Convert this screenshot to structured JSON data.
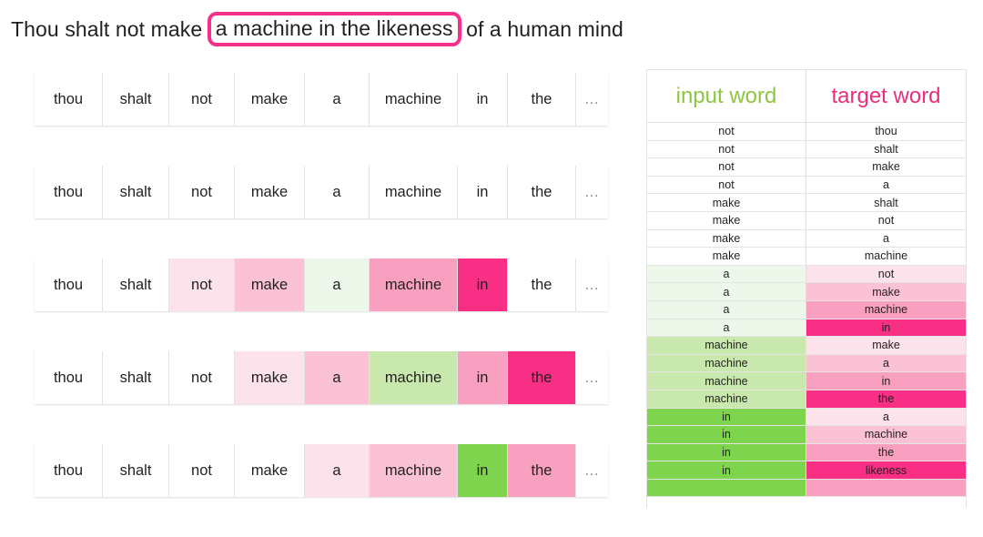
{
  "title": {
    "before": "Thou shalt not make",
    "highlight": "a machine in the likeness",
    "after": "of a human mind",
    "highlight_border_color": "#f7318a"
  },
  "palette": {
    "pink_1": "#fce2ea",
    "pink_2": "#fbc2d5",
    "pink_3": "#f9a0c0",
    "pink_4": "#f92f86",
    "green_1": "#eef8ea",
    "green_2": "#c8e8ae",
    "green_3": "#7fd44d",
    "white": "#ffffff",
    "header_green": "#8dc63f",
    "header_pink": "#ed2d7c",
    "border": "#e2e2e2"
  },
  "sentence_rows": [
    {
      "name": "row-1",
      "cells": [
        {
          "word": "thou",
          "bg": "#ffffff"
        },
        {
          "word": "shalt",
          "bg": "#ffffff"
        },
        {
          "word": "not",
          "bg": "#ffffff"
        },
        {
          "word": "make",
          "bg": "#ffffff"
        },
        {
          "word": "a",
          "bg": "#ffffff"
        },
        {
          "word": "machine",
          "bg": "#ffffff"
        },
        {
          "word": "in",
          "bg": "#ffffff"
        },
        {
          "word": "the",
          "bg": "#ffffff"
        },
        {
          "word": "…",
          "bg": "#ffffff"
        }
      ]
    },
    {
      "name": "row-2",
      "cells": [
        {
          "word": "thou",
          "bg": "#ffffff"
        },
        {
          "word": "shalt",
          "bg": "#ffffff"
        },
        {
          "word": "not",
          "bg": "#ffffff"
        },
        {
          "word": "make",
          "bg": "#ffffff"
        },
        {
          "word": "a",
          "bg": "#ffffff"
        },
        {
          "word": "machine",
          "bg": "#ffffff"
        },
        {
          "word": "in",
          "bg": "#ffffff"
        },
        {
          "word": "the",
          "bg": "#ffffff"
        },
        {
          "word": "…",
          "bg": "#ffffff"
        }
      ]
    },
    {
      "name": "row-3",
      "cells": [
        {
          "word": "thou",
          "bg": "#ffffff"
        },
        {
          "word": "shalt",
          "bg": "#ffffff"
        },
        {
          "word": "not",
          "bg": "#fce2ea"
        },
        {
          "word": "make",
          "bg": "#fbc2d5"
        },
        {
          "word": "a",
          "bg": "#eef8ea"
        },
        {
          "word": "machine",
          "bg": "#f9a0c0"
        },
        {
          "word": "in",
          "bg": "#f92f86"
        },
        {
          "word": "the",
          "bg": "#ffffff"
        },
        {
          "word": "…",
          "bg": "#ffffff"
        }
      ]
    },
    {
      "name": "row-4",
      "cells": [
        {
          "word": "thou",
          "bg": "#ffffff"
        },
        {
          "word": "shalt",
          "bg": "#ffffff"
        },
        {
          "word": "not",
          "bg": "#ffffff"
        },
        {
          "word": "make",
          "bg": "#fce2ea"
        },
        {
          "word": "a",
          "bg": "#fbc2d5"
        },
        {
          "word": "machine",
          "bg": "#c8e8ae"
        },
        {
          "word": "in",
          "bg": "#f9a0c0"
        },
        {
          "word": "the",
          "bg": "#f92f86"
        },
        {
          "word": "…",
          "bg": "#ffffff"
        }
      ]
    },
    {
      "name": "row-5",
      "cells": [
        {
          "word": "thou",
          "bg": "#ffffff"
        },
        {
          "word": "shalt",
          "bg": "#ffffff"
        },
        {
          "word": "not",
          "bg": "#ffffff"
        },
        {
          "word": "make",
          "bg": "#ffffff"
        },
        {
          "word": "a",
          "bg": "#fce2ea"
        },
        {
          "word": "machine",
          "bg": "#fbc2d5"
        },
        {
          "word": "in",
          "bg": "#7fd44d"
        },
        {
          "word": "the",
          "bg": "#f9a0c0"
        },
        {
          "word": "…",
          "bg": "#ffffff"
        }
      ]
    }
  ],
  "table": {
    "headers": {
      "input": "input word",
      "target": "target word"
    },
    "rows": [
      {
        "input": "not",
        "target": "thou",
        "input_bg": "#ffffff",
        "target_bg": "#ffffff"
      },
      {
        "input": "not",
        "target": "shalt",
        "input_bg": "#ffffff",
        "target_bg": "#ffffff"
      },
      {
        "input": "not",
        "target": "make",
        "input_bg": "#ffffff",
        "target_bg": "#ffffff"
      },
      {
        "input": "not",
        "target": "a",
        "input_bg": "#ffffff",
        "target_bg": "#ffffff"
      },
      {
        "input": "make",
        "target": "shalt",
        "input_bg": "#ffffff",
        "target_bg": "#ffffff"
      },
      {
        "input": "make",
        "target": "not",
        "input_bg": "#ffffff",
        "target_bg": "#ffffff"
      },
      {
        "input": "make",
        "target": "a",
        "input_bg": "#ffffff",
        "target_bg": "#ffffff"
      },
      {
        "input": "make",
        "target": "machine",
        "input_bg": "#ffffff",
        "target_bg": "#ffffff"
      },
      {
        "input": "a",
        "target": "not",
        "input_bg": "#eef8ea",
        "target_bg": "#fce2ea"
      },
      {
        "input": "a",
        "target": "make",
        "input_bg": "#eef8ea",
        "target_bg": "#fbc2d5"
      },
      {
        "input": "a",
        "target": "machine",
        "input_bg": "#eef8ea",
        "target_bg": "#f9a0c0"
      },
      {
        "input": "a",
        "target": "in",
        "input_bg": "#eef8ea",
        "target_bg": "#f92f86"
      },
      {
        "input": "machine",
        "target": "make",
        "input_bg": "#c8e8ae",
        "target_bg": "#fce2ea"
      },
      {
        "input": "machine",
        "target": "a",
        "input_bg": "#c8e8ae",
        "target_bg": "#fbc2d5"
      },
      {
        "input": "machine",
        "target": "in",
        "input_bg": "#c8e8ae",
        "target_bg": "#f9a0c0"
      },
      {
        "input": "machine",
        "target": "the",
        "input_bg": "#c8e8ae",
        "target_bg": "#f92f86"
      },
      {
        "input": "in",
        "target": "a",
        "input_bg": "#7fd44d",
        "target_bg": "#fce2ea"
      },
      {
        "input": "in",
        "target": "machine",
        "input_bg": "#7fd44d",
        "target_bg": "#fbc2d5"
      },
      {
        "input": "in",
        "target": "the",
        "input_bg": "#7fd44d",
        "target_bg": "#f9a0c0"
      },
      {
        "input": "in",
        "target": "likeness",
        "input_bg": "#7fd44d",
        "target_bg": "#f92f86"
      },
      {
        "input": "",
        "target": "",
        "input_bg": "#7fd44d",
        "target_bg": "#f9a0c0"
      }
    ]
  }
}
